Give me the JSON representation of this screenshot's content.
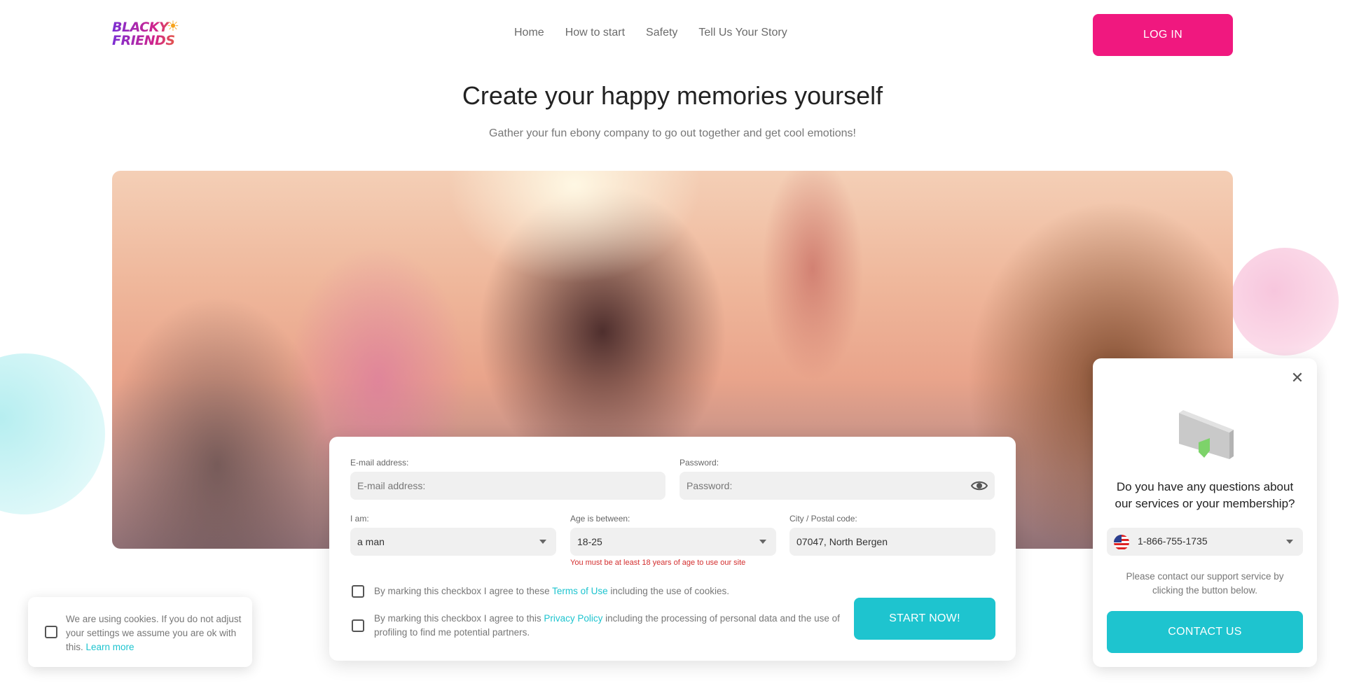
{
  "header": {
    "logo_line1": "BLACKY",
    "logo_line2": "FRIENDS",
    "nav": [
      "Home",
      "How to start",
      "Safety",
      "Tell Us Your Story"
    ],
    "login_label": "LOG IN"
  },
  "hero": {
    "title": "Create your happy memories yourself",
    "subtitle": "Gather your fun ebony company to go out together and get cool emotions!"
  },
  "form": {
    "email_label": "E-mail address:",
    "email_placeholder": "E-mail address:",
    "password_label": "Password:",
    "password_placeholder": "Password:",
    "iam_label": "I am:",
    "iam_value": "a man",
    "age_label": "Age is between:",
    "age_value": "18-25",
    "age_error": "You must be at least 18 years of age to use our site",
    "city_label": "City / Postal code:",
    "city_value": "07047, North Bergen",
    "terms_prefix": "By marking this checkbox I agree to these ",
    "terms_link": "Terms of Use",
    "terms_suffix": " including the use of cookies.",
    "privacy_prefix": "By marking this checkbox I agree to this ",
    "privacy_link": "Privacy Policy",
    "privacy_suffix": " including the processing of personal data and the use of profiling to find me potential partners.",
    "start_label": "START NOW!"
  },
  "cookie": {
    "text": "We are using cookies. If you do not adjust your settings we assume you are ok with this. ",
    "link": "Learn more"
  },
  "support": {
    "question": "Do you have any questions about our services or your membership?",
    "phone": "1-866-755-1735",
    "note": "Please contact our support service by clicking the button below.",
    "contact_label": "CONTACT US"
  },
  "colors": {
    "brand_pink": "#f0187f",
    "accent_teal": "#1ec4cf",
    "error_red": "#d32f2f"
  },
  "icons": {
    "logo_sun": "sun-with-sunglasses-icon",
    "password_toggle": "eye-icon",
    "dropdown": "caret-down-icon",
    "close": "close-icon",
    "flag": "us-flag-icon",
    "support_illustration": "phone-shield-icon"
  }
}
